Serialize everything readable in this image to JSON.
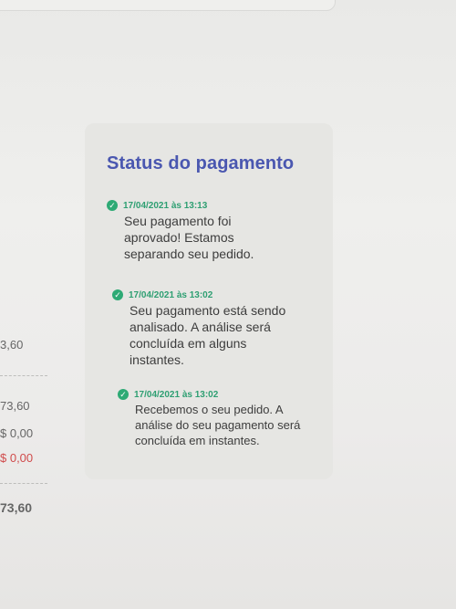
{
  "summary": {
    "values": [
      "3,60",
      "73,60",
      "$ 0,00",
      "$ 0,00",
      "73,60"
    ]
  },
  "status_panel": {
    "title": "Status do pagamento",
    "events": [
      {
        "time": "17/04/2021 às 13:13",
        "message": "Seu pagamento foi aprovado! Estamos separando seu pedido."
      },
      {
        "time": "17/04/2021 às 13:02",
        "message": "Seu pagamento está sendo analisado. A análise será concluída em alguns instantes."
      },
      {
        "time": "17/04/2021 às 13:02",
        "message": "Recebemos o seu pedido. A análise do seu pagamento será concluída em instantes."
      }
    ]
  },
  "colors": {
    "title": "#4a57b0",
    "success": "#2eaa75",
    "negative": "#d04b4b"
  },
  "icons": {
    "event": "check-circle-icon"
  }
}
